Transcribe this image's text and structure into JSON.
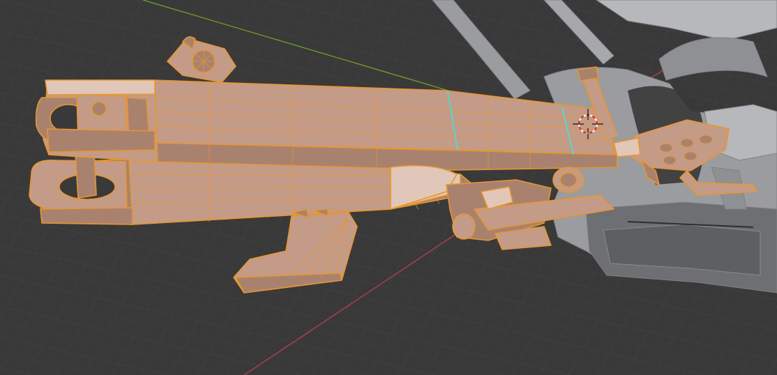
{
  "viewport": {
    "background_color": "#393939",
    "grid_color": "#464646",
    "grid_minor_color": "#3f3f3f"
  },
  "axes": {
    "x_axis_color": "#b0404c",
    "y_axis_color": "#6f9a2a"
  },
  "selection": {
    "fill_color": "#c49b87",
    "shade_color": "#a9826f",
    "dark_color": "#8c6a59",
    "edge_color": "#e8962e",
    "seam_color": "#58d6d0"
  },
  "unselected": {
    "fill_color": "#9a9c9f",
    "light_color": "#b6b8bb",
    "dark_color": "#6d6f72",
    "edge_color": "#7f8184"
  },
  "cursor": {
    "icon": "3d-cursor-icon"
  }
}
